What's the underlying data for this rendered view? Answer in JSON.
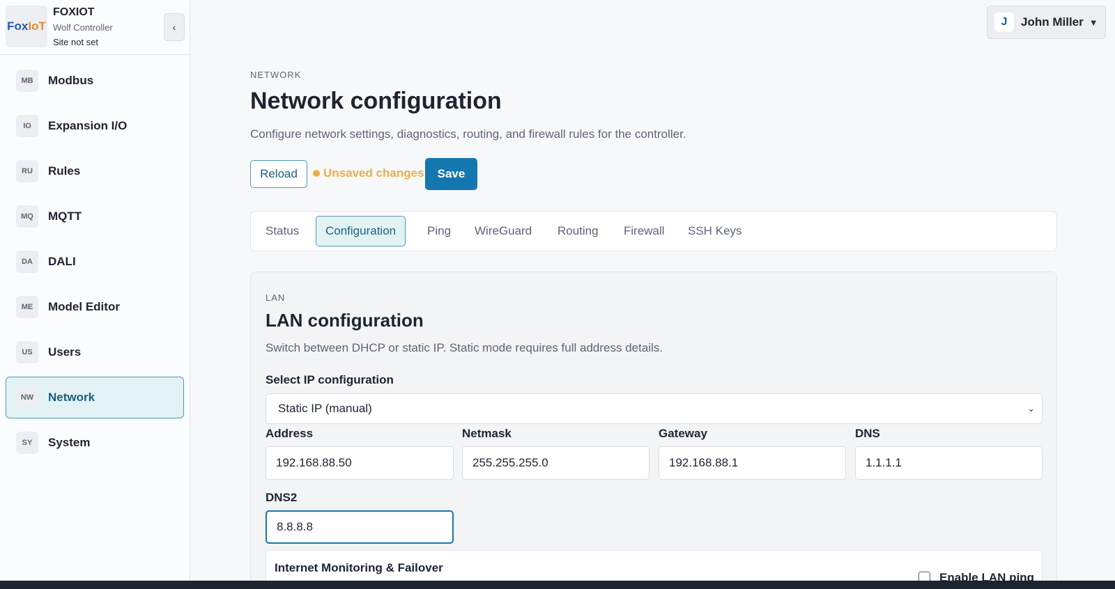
{
  "brand": {
    "logo_text_a": "Fox",
    "logo_text_b": "IoT",
    "name": "FOXIOT",
    "subtitle": "Wolf Controller",
    "site": "Site not set",
    "collapse_icon": "‹"
  },
  "sidebar": {
    "items": [
      {
        "badge": "MB",
        "label": "Modbus"
      },
      {
        "badge": "IO",
        "label": "Expansion I/O"
      },
      {
        "badge": "RU",
        "label": "Rules"
      },
      {
        "badge": "MQ",
        "label": "MQTT"
      },
      {
        "badge": "DA",
        "label": "DALI"
      },
      {
        "badge": "ME",
        "label": "Model Editor"
      },
      {
        "badge": "US",
        "label": "Users"
      },
      {
        "badge": "NW",
        "label": "Network"
      },
      {
        "badge": "SY",
        "label": "System"
      }
    ],
    "active": "Network"
  },
  "user": {
    "initial": "J",
    "name": "John Miller",
    "caret": "▼"
  },
  "header": {
    "eyebrow": "NETWORK",
    "title": "Network configuration",
    "description": "Configure network settings, diagnostics, routing, and firewall rules for the controller."
  },
  "actions": {
    "reload_label": "Reload",
    "unsaved_label": "Unsaved changes",
    "save_label": "Save"
  },
  "tabs": [
    {
      "label": "Status"
    },
    {
      "label": "Configuration"
    },
    {
      "label": "Ping"
    },
    {
      "label": "WireGuard"
    },
    {
      "label": "Routing"
    },
    {
      "label": "Firewall"
    },
    {
      "label": "SSH Keys"
    }
  ],
  "active_tab": "Configuration",
  "lan": {
    "eyebrow": "LAN",
    "title": "LAN configuration",
    "description": "Switch between DHCP or static IP. Static mode requires full address details.",
    "select_label": "Select IP configuration",
    "select_value": "Static IP (manual)",
    "fields": {
      "address": {
        "label": "Address",
        "value": "192.168.88.50"
      },
      "netmask": {
        "label": "Netmask",
        "value": "255.255.255.0"
      },
      "gateway": {
        "label": "Gateway",
        "value": "192.168.88.1"
      },
      "dns": {
        "label": "DNS",
        "value": "1.1.1.1"
      },
      "dns2": {
        "label": "DNS2",
        "value": "8.8.8.8"
      }
    }
  },
  "monitoring": {
    "title": "Internet Monitoring & Failover",
    "enable_lan_ping_label": "Enable LAN ping"
  },
  "colors": {
    "accent": "#1577b0",
    "active_bg": "#e3f3f5",
    "warning": "#e8b04a"
  }
}
